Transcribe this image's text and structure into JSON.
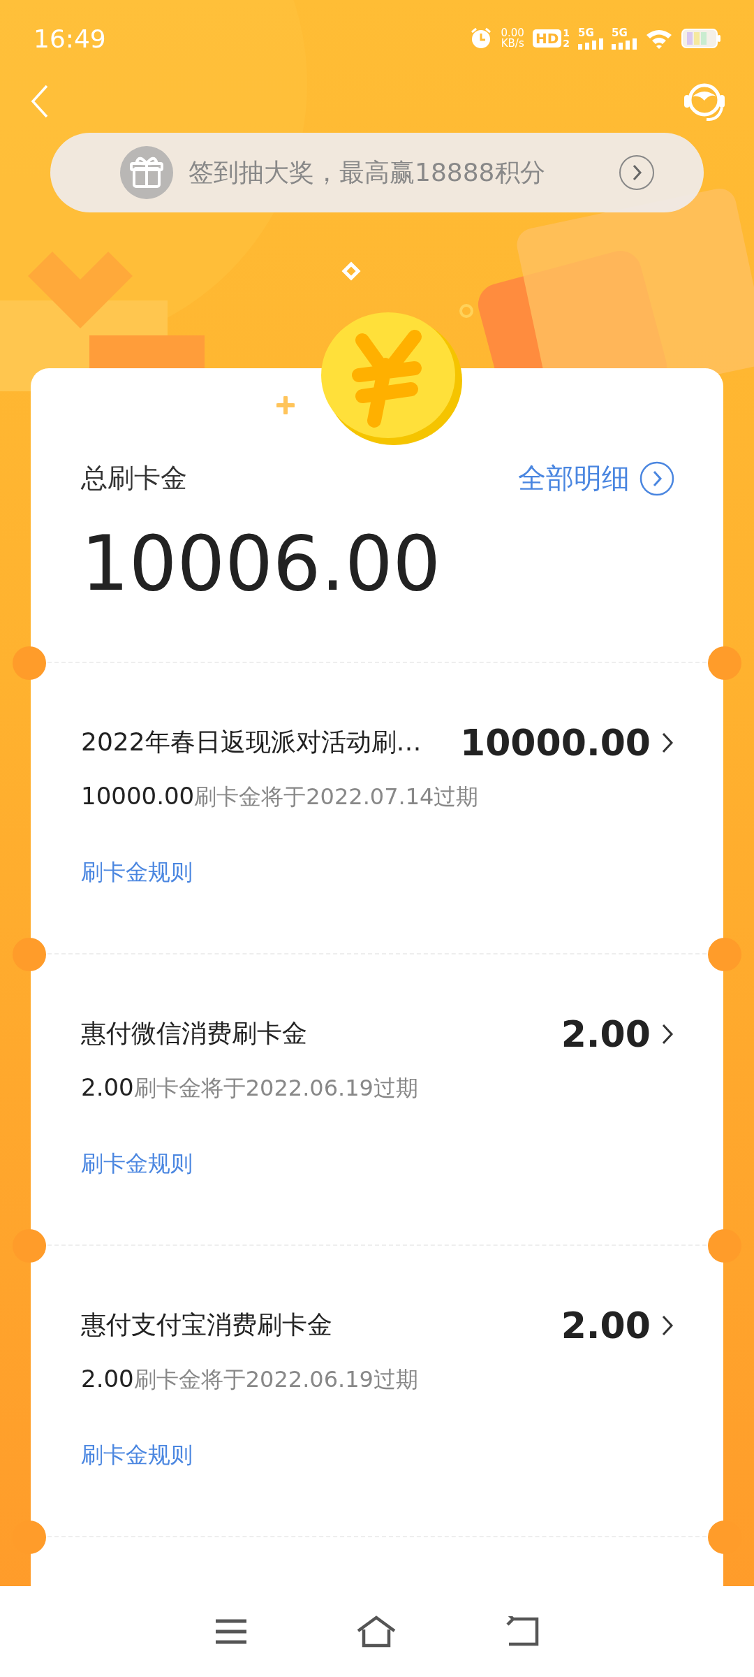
{
  "status_bar": {
    "time": "16:49",
    "net_speed": "0.00",
    "net_unit": "KB/s",
    "hd": "HD",
    "sim_slots": [
      "1",
      "2"
    ],
    "networks": [
      "5G",
      "5G"
    ]
  },
  "banner": {
    "text": "签到抽大奖，最高赢18888积分"
  },
  "summary": {
    "label": "总刷卡金",
    "link": "全部明细",
    "total": "10006.00"
  },
  "items": [
    {
      "title": "2022年春日返现派对活动刷…",
      "amount": "10000.00",
      "expiry_amount": "10000.00",
      "expiry_text": "刷卡金将于2022.07.14过期",
      "rule_link": "刷卡金规则"
    },
    {
      "title": "惠付微信消费刷卡金",
      "amount": "2.00",
      "expiry_amount": "2.00",
      "expiry_text": "刷卡金将于2022.06.19过期",
      "rule_link": "刷卡金规则"
    },
    {
      "title": "惠付支付宝消费刷卡金",
      "amount": "2.00",
      "expiry_amount": "2.00",
      "expiry_text": "刷卡金将于2022.06.19过期",
      "rule_link": "刷卡金规则"
    }
  ]
}
